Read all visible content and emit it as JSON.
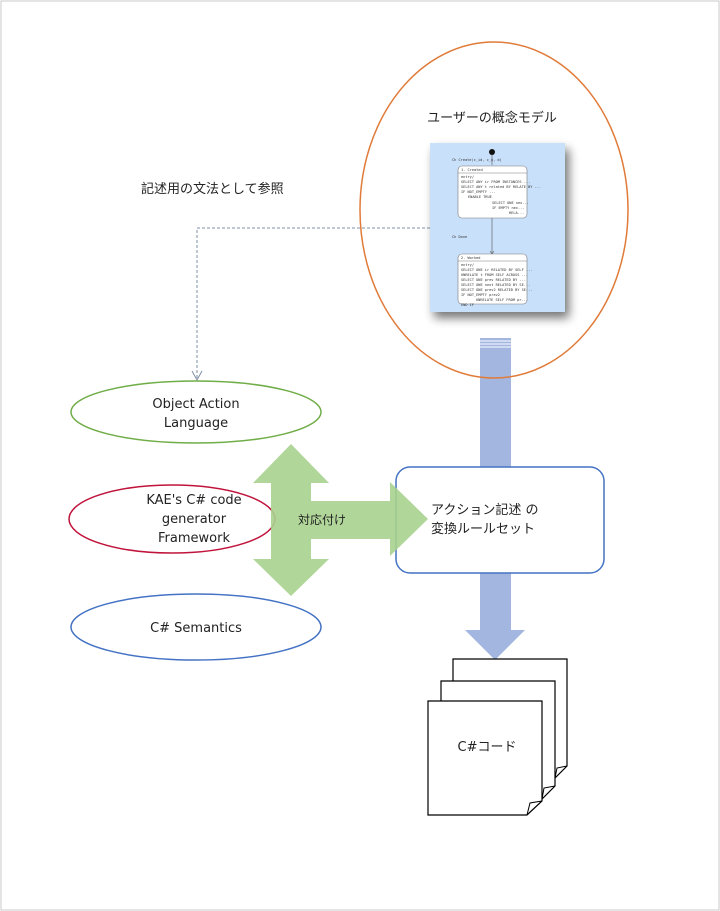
{
  "concept_model": {
    "title": "ユーザーの概念モデル",
    "thumbnail": {
      "top_label": "Ch Create(c_id, c_n, d)",
      "state1_title": "1. Created",
      "state1_lines": [
        "entry/",
        "SELECT ANY ir FROM INSTANCES ...",
        "SELECT ANY t related BY RELATE BY ...",
        "IF NOT_EMPTY ...",
        "ENABLE TRUE",
        "SELECT ONE nex...",
        "IF EMPTY nex...",
        "RELA..."
      ],
      "mid_label": "Ch Done",
      "state2_title": "2. Worked",
      "state2_lines": [
        "entry/",
        "SELECT ONE ir RELATED BY SELF ...",
        "UNRELATE t FROM SELF ACROSS ...",
        "SELECT ONE prev RELATED BY ...",
        "SELECT ONE next RELATED BY SE...",
        "SELECT ONE prev2 RELATED BY SE...",
        "IF NOT_EMPTY prev2",
        "UNRELATE SELF FROM pr...",
        "END IF"
      ]
    }
  },
  "grammar_ref_label": "記述用の文法として参照",
  "oal_label_lines": [
    "Object Action",
    "Language"
  ],
  "framework_label_lines": [
    "KAE's C# code",
    "generator",
    "Framework"
  ],
  "semantics_label": "C# Semantics",
  "mapping_label": "対応付け",
  "ruleset_label_lines": [
    "アクション記述 の",
    "変換ルールセット"
  ],
  "output_label": "C#コード",
  "colors": {
    "orange": "#e07b39",
    "green": "#70ad47",
    "crimson": "#c0143c",
    "blue": "#4472c4",
    "arrow_blue": "#a2b6e0",
    "arrow_green": "#a9d18e"
  }
}
